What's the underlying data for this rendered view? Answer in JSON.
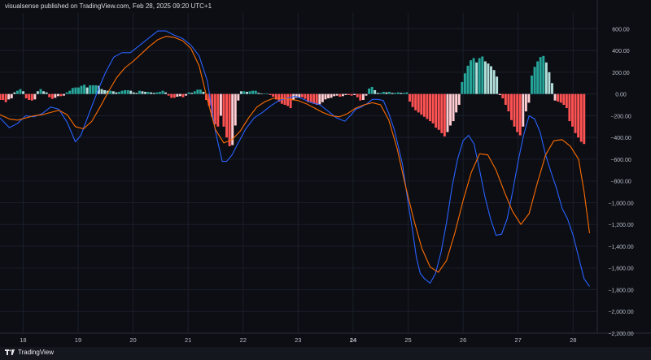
{
  "header": {
    "published_text": "visualsense published on TradingView.com, Feb 28, 2025 09:20 UTC+1"
  },
  "footer": {
    "brand": "TradingView"
  },
  "chart_data": {
    "type": "line",
    "title": "",
    "indicator": "MACD",
    "grid": true,
    "x_tick_labels": [
      "18",
      "19",
      "20",
      "21",
      "22",
      "23",
      "24",
      "25",
      "26",
      "27",
      "28"
    ],
    "x_tick_bold": [
      false,
      false,
      false,
      false,
      false,
      false,
      true,
      false,
      false,
      false,
      false
    ],
    "x_range": [
      17.58,
      28.44
    ],
    "ylim": [
      -2200,
      700
    ],
    "y_ticks": [
      600,
      400,
      200,
      0,
      -200,
      -400,
      -600,
      -800,
      -1000,
      -1200,
      -1400,
      -1600,
      -1800,
      -2000,
      -2200
    ],
    "y_tick_labels": [
      "600.00",
      "400.00",
      "200.00",
      "0.00",
      "−200.00",
      "−400.00",
      "−600.00",
      "−800.00",
      "−1,000.00",
      "−1,200.00",
      "−1,400.00",
      "−1,600.00",
      "−1,800.00",
      "−2,000.00",
      "−2,200.00"
    ],
    "colors": {
      "macd_line": "#2962ff",
      "signal_line": "#ff6d00",
      "hist_pos_strong": "#26a69a",
      "hist_pos_weak": "#b2dfdb",
      "hist_neg_strong": "#ff5252",
      "hist_neg_weak": "#ffcdd2"
    },
    "series": [
      {
        "key": "macd",
        "x": [
          17.58,
          17.75,
          17.9,
          18.05,
          18.2,
          18.35,
          18.5,
          18.65,
          18.8,
          18.95,
          19.05,
          19.2,
          19.35,
          19.5,
          19.65,
          19.8,
          19.95,
          20.1,
          20.3,
          20.45,
          20.6,
          20.75,
          20.9,
          21.05,
          21.2,
          21.35,
          21.5,
          21.62,
          21.7,
          21.8,
          21.9,
          22.05,
          22.2,
          22.35,
          22.5,
          22.65,
          22.8,
          22.95,
          23.1,
          23.25,
          23.4,
          23.55,
          23.7,
          23.85,
          23.95,
          24.05,
          24.15,
          24.25,
          24.35,
          24.45,
          24.55,
          24.65,
          24.75,
          24.9,
          25.0,
          25.08,
          25.15,
          25.22,
          25.3,
          25.4,
          25.5,
          25.6,
          25.7,
          25.8,
          25.9,
          26.0,
          26.1,
          26.2,
          26.3,
          26.4,
          26.5,
          26.6,
          26.7,
          26.8,
          26.9,
          27.0,
          27.1,
          27.2,
          27.3,
          27.4,
          27.5,
          27.6,
          27.7,
          27.8,
          27.9,
          28.0,
          28.1,
          28.2,
          28.3
        ],
        "y": [
          -220,
          -310,
          -270,
          -200,
          -210,
          -180,
          -120,
          -140,
          -260,
          -440,
          -380,
          -180,
          20,
          200,
          340,
          380,
          380,
          440,
          520,
          580,
          580,
          540,
          510,
          450,
          350,
          120,
          -350,
          -620,
          -620,
          -560,
          -460,
          -320,
          -220,
          -170,
          -110,
          -60,
          -40,
          -20,
          -50,
          -80,
          -100,
          -160,
          -220,
          -250,
          -200,
          -140,
          -120,
          -90,
          -50,
          -50,
          -60,
          -180,
          -330,
          -650,
          -1000,
          -1250,
          -1500,
          -1650,
          -1700,
          -1740,
          -1650,
          -1450,
          -1180,
          -850,
          -600,
          -430,
          -380,
          -460,
          -700,
          -950,
          -1150,
          -1300,
          -1290,
          -1150,
          -900,
          -620,
          -380,
          -200,
          -230,
          -350,
          -560,
          -720,
          -870,
          -1050,
          -1150,
          -1300,
          -1500,
          -1700,
          -1770
        ]
      },
      {
        "key": "signal",
        "x": [
          17.58,
          17.75,
          17.9,
          18.05,
          18.2,
          18.35,
          18.5,
          18.65,
          18.8,
          18.95,
          19.1,
          19.25,
          19.4,
          19.55,
          19.7,
          19.85,
          20.0,
          20.15,
          20.3,
          20.45,
          20.6,
          20.75,
          20.9,
          21.05,
          21.2,
          21.35,
          21.5,
          21.65,
          21.8,
          21.95,
          22.1,
          22.25,
          22.4,
          22.55,
          22.7,
          22.85,
          23.0,
          23.15,
          23.3,
          23.45,
          23.6,
          23.75,
          23.9,
          24.05,
          24.2,
          24.35,
          24.5,
          24.65,
          24.8,
          24.95,
          25.1,
          25.25,
          25.4,
          25.55,
          25.7,
          25.85,
          26.0,
          26.15,
          26.3,
          26.45,
          26.6,
          26.75,
          26.9,
          27.05,
          27.2,
          27.35,
          27.5,
          27.65,
          27.8,
          27.95,
          28.1,
          28.2,
          28.3
        ],
        "y": [
          -190,
          -230,
          -240,
          -220,
          -200,
          -190,
          -170,
          -150,
          -190,
          -300,
          -320,
          -250,
          -120,
          20,
          150,
          240,
          300,
          370,
          440,
          500,
          530,
          520,
          490,
          420,
          260,
          -50,
          -330,
          -450,
          -420,
          -340,
          -220,
          -120,
          -70,
          -40,
          -40,
          -50,
          -60,
          -90,
          -130,
          -170,
          -200,
          -210,
          -180,
          -130,
          -100,
          -80,
          -100,
          -240,
          -500,
          -840,
          -1150,
          -1420,
          -1590,
          -1640,
          -1530,
          -1280,
          -980,
          -720,
          -550,
          -560,
          -700,
          -900,
          -1080,
          -1200,
          -1100,
          -820,
          -560,
          -430,
          -420,
          -480,
          -600,
          -900,
          -1280
        ]
      }
    ],
    "histogram": {
      "x_start": 17.58,
      "x_end": 28.2,
      "values": [
        -55,
        -55,
        -75,
        -50,
        -40,
        15,
        30,
        45,
        25,
        -40,
        -55,
        -60,
        -50,
        25,
        45,
        25,
        15,
        -30,
        -45,
        -35,
        -20,
        -20,
        -15,
        15,
        30,
        55,
        60,
        60,
        75,
        85,
        60,
        80,
        80,
        80,
        75,
        45,
        35,
        30,
        30,
        25,
        15,
        20,
        30,
        35,
        35,
        30,
        15,
        10,
        30,
        25,
        20,
        20,
        15,
        10,
        15,
        20,
        30,
        15,
        -15,
        -35,
        -35,
        -25,
        -20,
        -30,
        -15,
        15,
        10,
        25,
        40,
        40,
        20,
        -55,
        -110,
        -210,
        -280,
        -300,
        -200,
        -300,
        -400,
        -480,
        -470,
        -290,
        -60,
        25,
        25,
        20,
        25,
        30,
        30,
        10,
        5,
        5,
        5,
        -10,
        -25,
        -50,
        -70,
        -90,
        -100,
        -110,
        -130,
        -55,
        -35,
        -30,
        -30,
        -45,
        -75,
        -80,
        -90,
        -100,
        -95,
        -75,
        -50,
        -40,
        -35,
        -20,
        -15,
        -25,
        -20,
        -10,
        -10,
        -15,
        -10,
        -30,
        -60,
        -55,
        -15,
        50,
        65,
        35,
        10,
        10,
        20,
        15,
        20,
        10,
        10,
        15,
        10,
        10,
        15,
        -70,
        -120,
        -150,
        -170,
        -190,
        -210,
        -230,
        -250,
        -270,
        -310,
        -330,
        -360,
        -390,
        -350,
        -290,
        -250,
        -170,
        -100,
        110,
        190,
        260,
        310,
        330,
        290,
        330,
        345,
        300,
        280,
        255,
        220,
        160,
        -10,
        -40,
        -100,
        -160,
        -240,
        -300,
        -350,
        -380,
        -300,
        -160,
        -80,
        170,
        250,
        300,
        340,
        350,
        290,
        200,
        100,
        -60,
        -70,
        -80,
        -100,
        -130,
        -250,
        -300,
        -360,
        -400,
        -440,
        -460
      ]
    }
  }
}
